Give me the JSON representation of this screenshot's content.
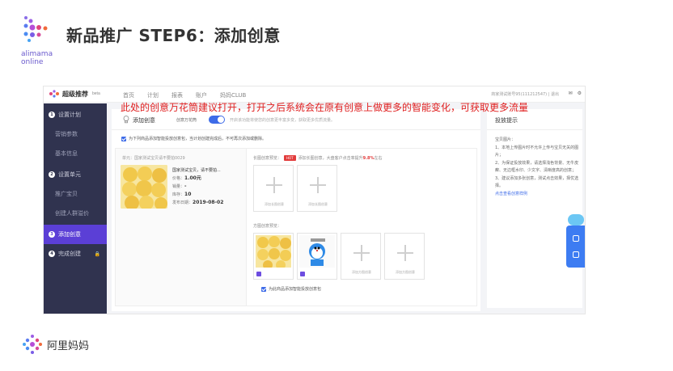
{
  "slide": {
    "title": "新品推广 STEP6：添加创意",
    "brand_line1": "alimama",
    "brand_line2": "online",
    "footer_brand": "阿里妈妈",
    "annotation": "此处的创意万花筒建议打开，打开之后系统会在原有创意上做更多的智能变化，可获取更多流量"
  },
  "app": {
    "logo_title": "超级推荐",
    "logo_beta": "beta",
    "nav": [
      "首页",
      "计划",
      "报表",
      "账户",
      "妈妈CLUB"
    ],
    "user_text": "商家测试账号95(111212547) | 退出",
    "icons": [
      "mail-icon",
      "settings-icon"
    ]
  },
  "sidebar": {
    "items": [
      {
        "num": "1",
        "label": "设置计划",
        "level": "main"
      },
      {
        "num": "",
        "label": "营销参数",
        "level": "sub"
      },
      {
        "num": "",
        "label": "基本信息",
        "level": "sub"
      },
      {
        "num": "2",
        "label": "设置单元",
        "level": "main"
      },
      {
        "num": "",
        "label": "推广宝贝",
        "level": "sub"
      },
      {
        "num": "",
        "label": "创建人群溢价",
        "level": "sub"
      },
      {
        "num": "3",
        "label": "添加创意",
        "level": "main",
        "active": true
      },
      {
        "num": "4",
        "label": "完成创建",
        "level": "main"
      }
    ]
  },
  "card": {
    "heading": "添加创意",
    "switch_label": "创意万花筒",
    "switch_on": true,
    "switch_desc": "开启该功能将使您的创意更丰富多变，获取更多优质流量。",
    "check_all": "为下列商品添加智能投放创意包，当计划创建完成后，不可再次添加或删除。"
  },
  "product": {
    "unit": "单元：国家测试宝贝请不要拍0029",
    "name": "国家测试宝贝，请不要拍...",
    "price_label": "价格：",
    "price": "1.00元",
    "sales_label": "销量：",
    "sales": "-",
    "stock_label": "库存：",
    "stock": "10",
    "date_label": "发布日期：",
    "date": "2019-08-02"
  },
  "creative": {
    "long_label": "长图创意预览：",
    "hot": "HOT",
    "long_hint_pre": "添加长图创意，大盘客户点击率提升",
    "long_hint_val": "9.8%",
    "long_hint_post": "左右",
    "long_slots": [
      "添加长图创意",
      "添加长图创意"
    ],
    "square_label": "方图创意预览：",
    "square_slots": [
      "添加方图创意",
      "添加方图创意"
    ],
    "bottom_check": "为此商品添加智能投放创意包"
  },
  "tips": {
    "title": "投放提示",
    "lines": [
      "宝贝图片：",
      "1、本地上传图片时不允许上传与宝贝无关的图片；",
      "2、为保证投放效果，请选择浅色背景、无牛皮癣、无边框水印、少文字、清晰度高的创意；",
      "3、建议添加多张创意，测试点击效果，择优选择。"
    ],
    "link": "点击查看创意样例"
  },
  "colors": {
    "accent": "#3d6be8",
    "sidebar": "#30334f",
    "active": "#5b3fd6",
    "annotation": "#e02020"
  }
}
